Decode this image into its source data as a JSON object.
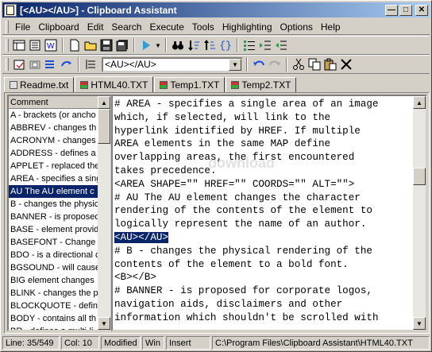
{
  "window": {
    "title": "[<AU></AU>] - Clipboard Assistant"
  },
  "menu": [
    "File",
    "Clipboard",
    "Edit",
    "Search",
    "Execute",
    "Tools",
    "Highlighting",
    "Options",
    "Help"
  ],
  "toolbar": {
    "combo_value": "<AU></AU>"
  },
  "tabs": [
    "Readme.txt",
    "HTML40.TXT",
    "Temp1.TXT",
    "Temp2.TXT"
  ],
  "list": {
    "header": "Comment",
    "items": [
      "A - brackets (or ancho",
      "ABBREV - changes th",
      "ACRONYM - changes",
      "ADDRESS - defines a",
      "APPLET - replaced the",
      "AREA - specifies a sing",
      "AU The AU element c",
      "B - changes the physic",
      "BANNER - is proposed",
      "BASE - element provid",
      "BASEFONT - Change",
      "BDO - is a directional c",
      "BGSOUND - will cause",
      "BIG  element changes",
      "BLINK - changes the p",
      "BLOCKQUOTE - defin",
      "BODY - contains all th",
      "BR - defines a multi-li"
    ],
    "selected_index": 6
  },
  "editor": {
    "lines": [
      "# AREA - specifies a single area of an image",
      "which, if selected, will link to the",
      "hyperlink identified by HREF. If multiple",
      "AREA elements in the same MAP define",
      "overlapping areas, the first encountered",
      "takes precedence.",
      "<AREA SHAPE=\"\" HREF=\"\" COORDS=\"\" ALT=\"\">",
      "# AU The AU element changes the character",
      "rendering of the contents of the element to",
      "logically represent the name of an author.",
      "<AU></AU>",
      "# B - changes the physical rendering of the",
      "contents of the element to a bold font.",
      "<B></B>",
      "# BANNER - is proposed for corporate logos,",
      "navigation aids, disclaimers and other",
      "information which shouldn't be scrolled with"
    ],
    "highlight_index": 10,
    "watermark": "download"
  },
  "status": {
    "line": "Line: 35/549",
    "col": "Col: 10",
    "modified": "Modified",
    "win": "Win",
    "insert": "Insert",
    "path": "C:\\Program Files\\Clipboard Assistant\\HTML40.TXT"
  }
}
